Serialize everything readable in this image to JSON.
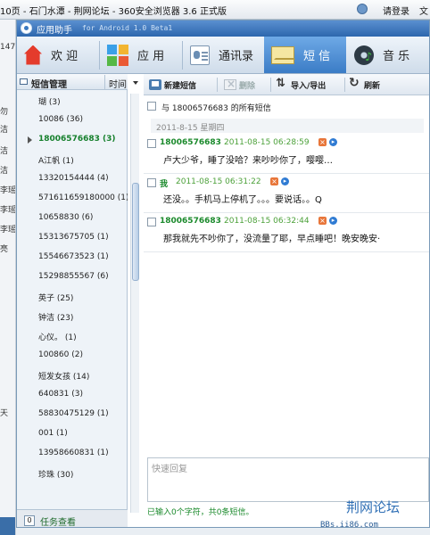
{
  "browser": {
    "title": "10页 - 石门水潭 - 荆网论坛 - 360安全浏览器 3.6 正式版",
    "login": "请登录",
    "right_text": "文"
  },
  "background_left": [
    "147",
    "勿",
    "洁",
    "洁",
    "洁",
    "李瑶",
    "李瑶",
    "李瑶",
    "亮",
    "天"
  ],
  "app": {
    "title": "应用助手",
    "version": "for Android 1.0 Beta1"
  },
  "nav": [
    {
      "label": "欢 迎",
      "icon": "home-icon"
    },
    {
      "label": "应 用",
      "icon": "apps-icon"
    },
    {
      "label": "通讯录",
      "icon": "contacts-icon"
    },
    {
      "label": "短 信",
      "icon": "sms-icon",
      "active": true
    },
    {
      "label": "音 乐",
      "icon": "music-icon"
    }
  ],
  "sidebar": {
    "header": "短信管理",
    "sort": "时间",
    "contacts": [
      {
        "name": "瑚 (3)"
      },
      {
        "name": "10086 (36)"
      },
      {
        "name": "18006576683 (3)",
        "active": true
      },
      {
        "name": "A江帆 (1)"
      },
      {
        "name": "13320154444 (4)"
      },
      {
        "name": "571611659180000 (1)"
      },
      {
        "name": "10658830 (6)"
      },
      {
        "name": "15313675705 (1)"
      },
      {
        "name": "15546673523 (1)"
      },
      {
        "name": "15298855567 (6)"
      },
      {
        "name": "英子 (25)"
      },
      {
        "name": "钟洁 (23)"
      },
      {
        "name": "心仪。 (1)"
      },
      {
        "name": "100860 (2)"
      },
      {
        "name": "短发女孩 (14)"
      },
      {
        "name": "640831 (3)"
      },
      {
        "name": "58830475129 (1)"
      },
      {
        "name": "001 (1)"
      },
      {
        "name": "13958660831 (1)"
      },
      {
        "name": "珍珠 (30)"
      }
    ],
    "task_count": "0",
    "task_label": "任务查看"
  },
  "toolbar": {
    "new_sms": "新建短信",
    "delete": "删除",
    "import_export": "导入/导出",
    "refresh": "刷新"
  },
  "conversation": {
    "title": "与 18006576683 的所有短信",
    "date": "2011-8-15 星期四",
    "messages": [
      {
        "sender": "18006576683",
        "time": "2011-08-15 06:28:59",
        "text": "卢大少爷，睡了没哈？来吵吵你了，嘤嘤…"
      },
      {
        "sender": "我",
        "time": "2011-08-15 06:31:22",
        "text": "还没。。手机马上停机了。。。要说话。。Q"
      },
      {
        "sender": "18006576683",
        "time": "2011-08-15 06:32:44",
        "text": "那我就先不吵你了，没流量了耶，早点睡吧！晚安晚安·"
      }
    ]
  },
  "reply": {
    "placeholder": "快速回复",
    "status": "已输入0个字符，共0条短信。"
  },
  "footer": {
    "logo": "荆网论坛",
    "url": "BBs.ii86.com"
  },
  "colors": {
    "accent": "#3b7cc6",
    "sender_green": "#1b8a2c",
    "time_green": "#4ca13a"
  }
}
